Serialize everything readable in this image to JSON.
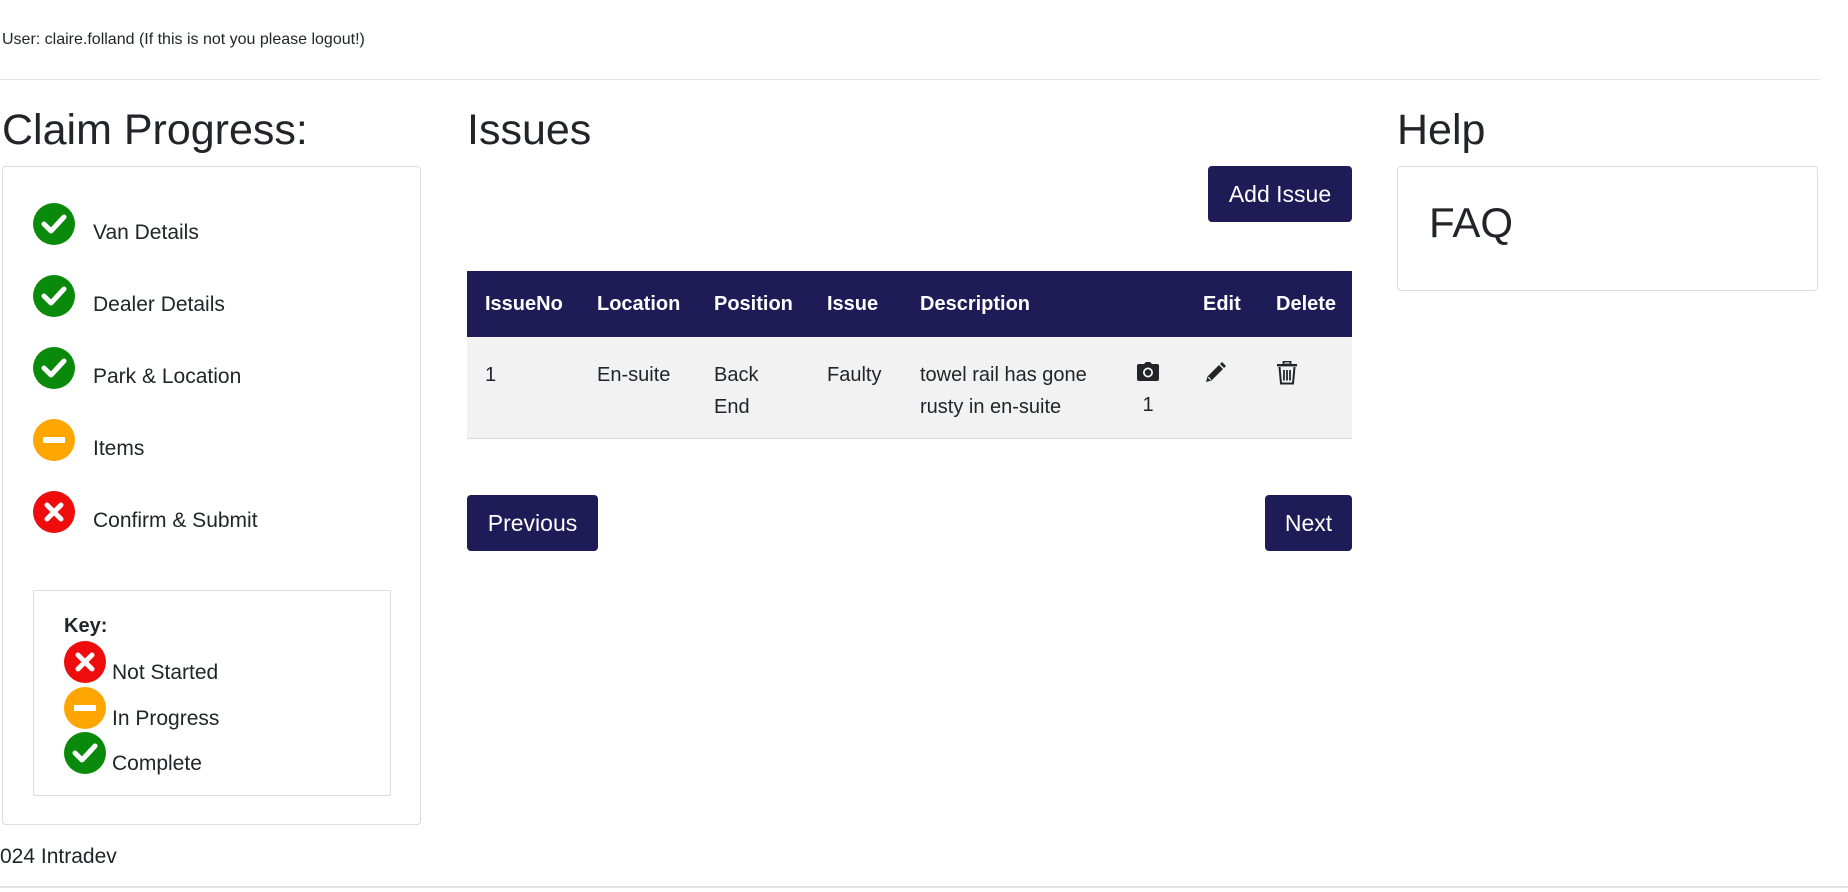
{
  "header": {
    "user_text": "User: claire.folland (If this is not you please logout!)"
  },
  "progress": {
    "title": "Claim Progress:",
    "steps": [
      {
        "label": "Van Details",
        "status": "complete",
        "icon": "check-circle-icon"
      },
      {
        "label": "Dealer Details",
        "status": "complete",
        "icon": "check-circle-icon"
      },
      {
        "label": "Park & Location",
        "status": "complete",
        "icon": "check-circle-icon"
      },
      {
        "label": "Items",
        "status": "in-progress",
        "icon": "minus-circle-icon"
      },
      {
        "label": "Confirm & Submit",
        "status": "not-started",
        "icon": "x-circle-icon"
      }
    ],
    "key": {
      "title": "Key:",
      "items": [
        {
          "label": "Not Started",
          "icon": "x-circle-icon"
        },
        {
          "label": "In Progress",
          "icon": "minus-circle-icon"
        },
        {
          "label": "Complete",
          "icon": "check-circle-icon"
        }
      ]
    }
  },
  "issues": {
    "title": "Issues",
    "add_label": "Add Issue",
    "columns": [
      "IssueNo",
      "Location",
      "Position",
      "Issue",
      "Description",
      "",
      "Edit",
      "Delete"
    ],
    "rows": [
      {
        "issue_no": "1",
        "location": "En-suite",
        "position_line1": "Back",
        "position_line2": "End",
        "issue": "Faulty",
        "description_line1": "towel rail has gone",
        "description_line2": "rusty in en-suite",
        "photo_count": "1"
      }
    ],
    "previous_label": "Previous",
    "next_label": "Next"
  },
  "help": {
    "title": "Help",
    "faq_label": "FAQ"
  },
  "footer": {
    "text": "024 Intradev"
  },
  "colors": {
    "brand": "#1e1b57",
    "complete": "#0a8a0a",
    "in_progress": "#ffa500",
    "not_started": "#ee0c0c"
  }
}
